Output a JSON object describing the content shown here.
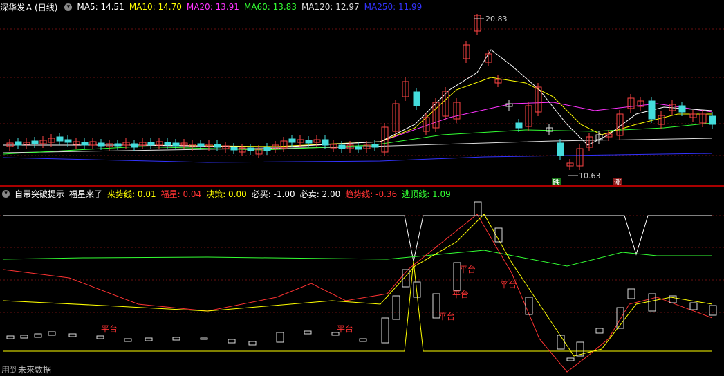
{
  "top": {
    "stock_name": "深华发Ａ",
    "period": "(日线)",
    "ma": [
      {
        "label": "MA5: 14.51",
        "color": "#ffffff"
      },
      {
        "label": "MA10: 14.70",
        "color": "#ffff00"
      },
      {
        "label": "MA20: 13.91",
        "color": "#ff33ff"
      },
      {
        "label": "MA60: 13.83",
        "color": "#33ff33"
      },
      {
        "label": "MA120: 12.97",
        "color": "#dddddd"
      },
      {
        "label": "MA250: 11.99",
        "color": "#3333ff"
      }
    ],
    "high_label": "20.83",
    "low_label": "10.63",
    "die_tag": "跌",
    "zhang_tag": "涨"
  },
  "indicator": {
    "name": "自带突破提示",
    "subtitle": "福星来了",
    "lines": [
      {
        "label": "来势线: 0.01",
        "color": "#ffff00"
      },
      {
        "label": "福星: 0.04",
        "color": "#ff3333"
      },
      {
        "label": "决策: 0.00",
        "color": "#ffff00"
      },
      {
        "label": "必买: -1.00",
        "color": "#ffffff"
      },
      {
        "label": "必卖: 2.00",
        "color": "#ffffff"
      },
      {
        "label": "趋势线: -0.36",
        "color": "#ff3333"
      },
      {
        "label": "逃顶线: 1.09",
        "color": "#33ff33"
      }
    ],
    "platform_label": "平台"
  },
  "footer": {
    "text": "用到未来数据"
  }
}
